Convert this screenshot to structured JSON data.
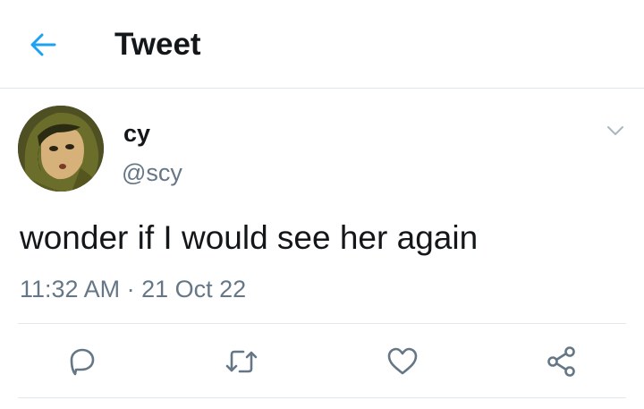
{
  "header": {
    "title": "Tweet",
    "back_icon": "arrow-left-icon",
    "accent_color": "#1da1f2"
  },
  "tweet": {
    "author": {
      "display_name": "cy",
      "handle": "@scy",
      "avatar": "avatar-image"
    },
    "text": "wonder if I would see her again",
    "time": "11:32 AM",
    "separator": "·",
    "date": "21 Oct 22"
  },
  "actions": [
    {
      "name": "reply",
      "icon": "reply-icon"
    },
    {
      "name": "retweet",
      "icon": "retweet-icon"
    },
    {
      "name": "like",
      "icon": "heart-icon"
    },
    {
      "name": "share",
      "icon": "share-icon"
    }
  ],
  "colors": {
    "text_primary": "#14171a",
    "text_secondary": "#657786",
    "divider": "#e1e8ed",
    "icon": "#657786"
  }
}
